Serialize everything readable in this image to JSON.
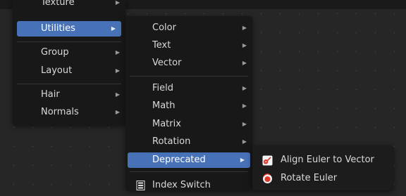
{
  "menu_main": {
    "items": [
      {
        "label": "Texture"
      },
      {
        "label": "Utilities"
      },
      {
        "label": "Group"
      },
      {
        "label": "Layout"
      },
      {
        "label": "Hair"
      },
      {
        "label": "Normals"
      }
    ]
  },
  "menu_utilities": {
    "items": [
      {
        "label": "Color"
      },
      {
        "label": "Text"
      },
      {
        "label": "Vector"
      },
      {
        "label": "Field"
      },
      {
        "label": "Math"
      },
      {
        "label": "Matrix"
      },
      {
        "label": "Rotation"
      },
      {
        "label": "Deprecated"
      },
      {
        "label": "Index Switch"
      }
    ]
  },
  "menu_deprecated": {
    "items": [
      {
        "label": "Align Euler to Vector",
        "icon": "align-euler-icon"
      },
      {
        "label": "Rotate Euler",
        "icon": "rotate-euler-icon"
      }
    ]
  },
  "colors": {
    "highlight": "#4872b7",
    "menu_bg": "#181818",
    "canvas_bg": "#262626"
  }
}
